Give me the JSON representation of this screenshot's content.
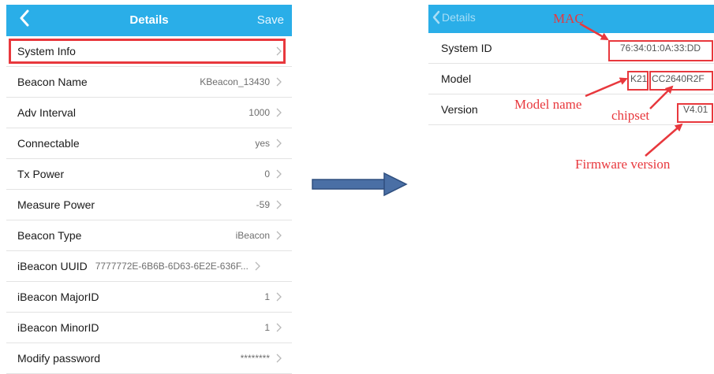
{
  "left_screen": {
    "nav": {
      "title": "Details",
      "save_label": "Save"
    },
    "rows": [
      {
        "label": "System Info",
        "value": ""
      },
      {
        "label": "Beacon Name",
        "value": "KBeacon_13430"
      },
      {
        "label": "Adv Interval",
        "value": "1000"
      },
      {
        "label": "Connectable",
        "value": "yes"
      },
      {
        "label": "Tx Power",
        "value": "0"
      },
      {
        "label": "Measure Power",
        "value": "-59"
      },
      {
        "label": "Beacon Type",
        "value": "iBeacon"
      },
      {
        "label": "iBeacon UUID",
        "value": "7777772E-6B6B-6D63-6E2E-636F..."
      },
      {
        "label": "iBeacon MajorID",
        "value": "1"
      },
      {
        "label": "iBeacon MinorID",
        "value": "1"
      },
      {
        "label": "Modify password",
        "value": "********"
      }
    ]
  },
  "right_screen": {
    "nav": {
      "back_label": "Details"
    },
    "rows": {
      "system_id": {
        "label": "System ID",
        "value": "76:34:01:0A:33:DD"
      },
      "model": {
        "label": "Model",
        "model_name": "K21",
        "chipset": "CC2640R2F"
      },
      "version": {
        "label": "Version",
        "value": "V4.01"
      }
    }
  },
  "annotations": {
    "mac": "MAC",
    "model_name": "Model name",
    "chipset": "chipset",
    "firmware": "Firmware version"
  },
  "colors": {
    "nav_bar": "#2aaee8",
    "highlight": "#e8383d",
    "arrow": "#4a6fa5"
  }
}
